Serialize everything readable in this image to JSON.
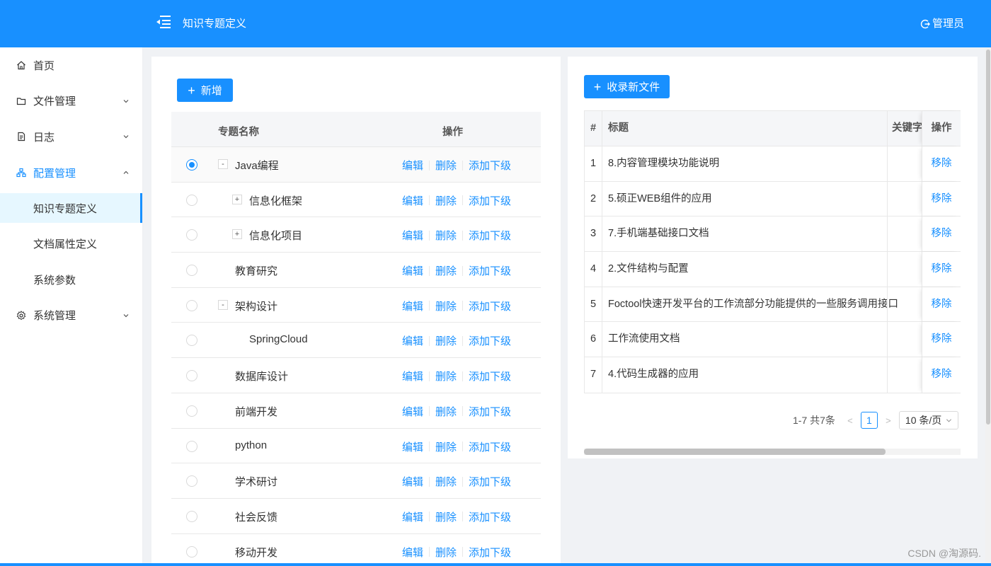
{
  "header": {
    "title": "知识专题定义",
    "user_label": "管理员"
  },
  "sidebar": {
    "items": [
      {
        "label": "首页",
        "icon": "home-icon"
      },
      {
        "label": "文件管理",
        "icon": "folder-icon",
        "expandable": true
      },
      {
        "label": "日志",
        "icon": "file-icon",
        "expandable": true
      },
      {
        "label": "配置管理",
        "icon": "cluster-icon",
        "expanded": true,
        "children": [
          {
            "label": "知识专题定义",
            "selected": true
          },
          {
            "label": "文档属性定义"
          },
          {
            "label": "系统参数"
          }
        ]
      },
      {
        "label": "系统管理",
        "icon": "setting-icon",
        "expandable": true
      }
    ]
  },
  "topics": {
    "add_button": "新增",
    "columns": {
      "name": "专题名称",
      "ops": "操作"
    },
    "op_labels": {
      "edit": "编辑",
      "delete": "删除",
      "add_child": "添加下级"
    },
    "rows": [
      {
        "name": "Java编程",
        "level": 0,
        "expander": "-",
        "checked": true
      },
      {
        "name": "信息化框架",
        "level": 1,
        "expander": "+"
      },
      {
        "name": "信息化项目",
        "level": 1,
        "expander": "+"
      },
      {
        "name": "教育研究",
        "level": 0
      },
      {
        "name": "架构设计",
        "level": 0,
        "expander": "-"
      },
      {
        "name": "SpringCloud",
        "level": 1
      },
      {
        "name": "数据库设计",
        "level": 0
      },
      {
        "name": "前端开发",
        "level": 0
      },
      {
        "name": "python",
        "level": 0
      },
      {
        "name": "学术研讨",
        "level": 0
      },
      {
        "name": "社会反馈",
        "level": 0
      },
      {
        "name": "移动开发",
        "level": 0
      }
    ]
  },
  "documents": {
    "add_button": "收录新文件",
    "columns": {
      "index": "#",
      "title": "标题",
      "keyword": "关键字",
      "op": "操作"
    },
    "remove_label": "移除",
    "rows": [
      {
        "index": "1",
        "title": "8.内容管理模块功能说明"
      },
      {
        "index": "2",
        "title": "5.硕正WEB组件的应用"
      },
      {
        "index": "3",
        "title": "7.手机端基础接口文档"
      },
      {
        "index": "4",
        "title": "2.文件结构与配置"
      },
      {
        "index": "5",
        "title": "Foctool快速开发平台的工作流部分功能提供的一些服务调用接口"
      },
      {
        "index": "6",
        "title": "工作流使用文档"
      },
      {
        "index": "7",
        "title": "4.代码生成器的应用"
      }
    ],
    "pagination": {
      "summary": "1-7 共7条",
      "current_page": "1",
      "page_size": "10 条/页"
    }
  },
  "watermark": "CSDN @淘源码.",
  "colors": {
    "primary": "#1890ff",
    "background": "#f0f2f5"
  }
}
